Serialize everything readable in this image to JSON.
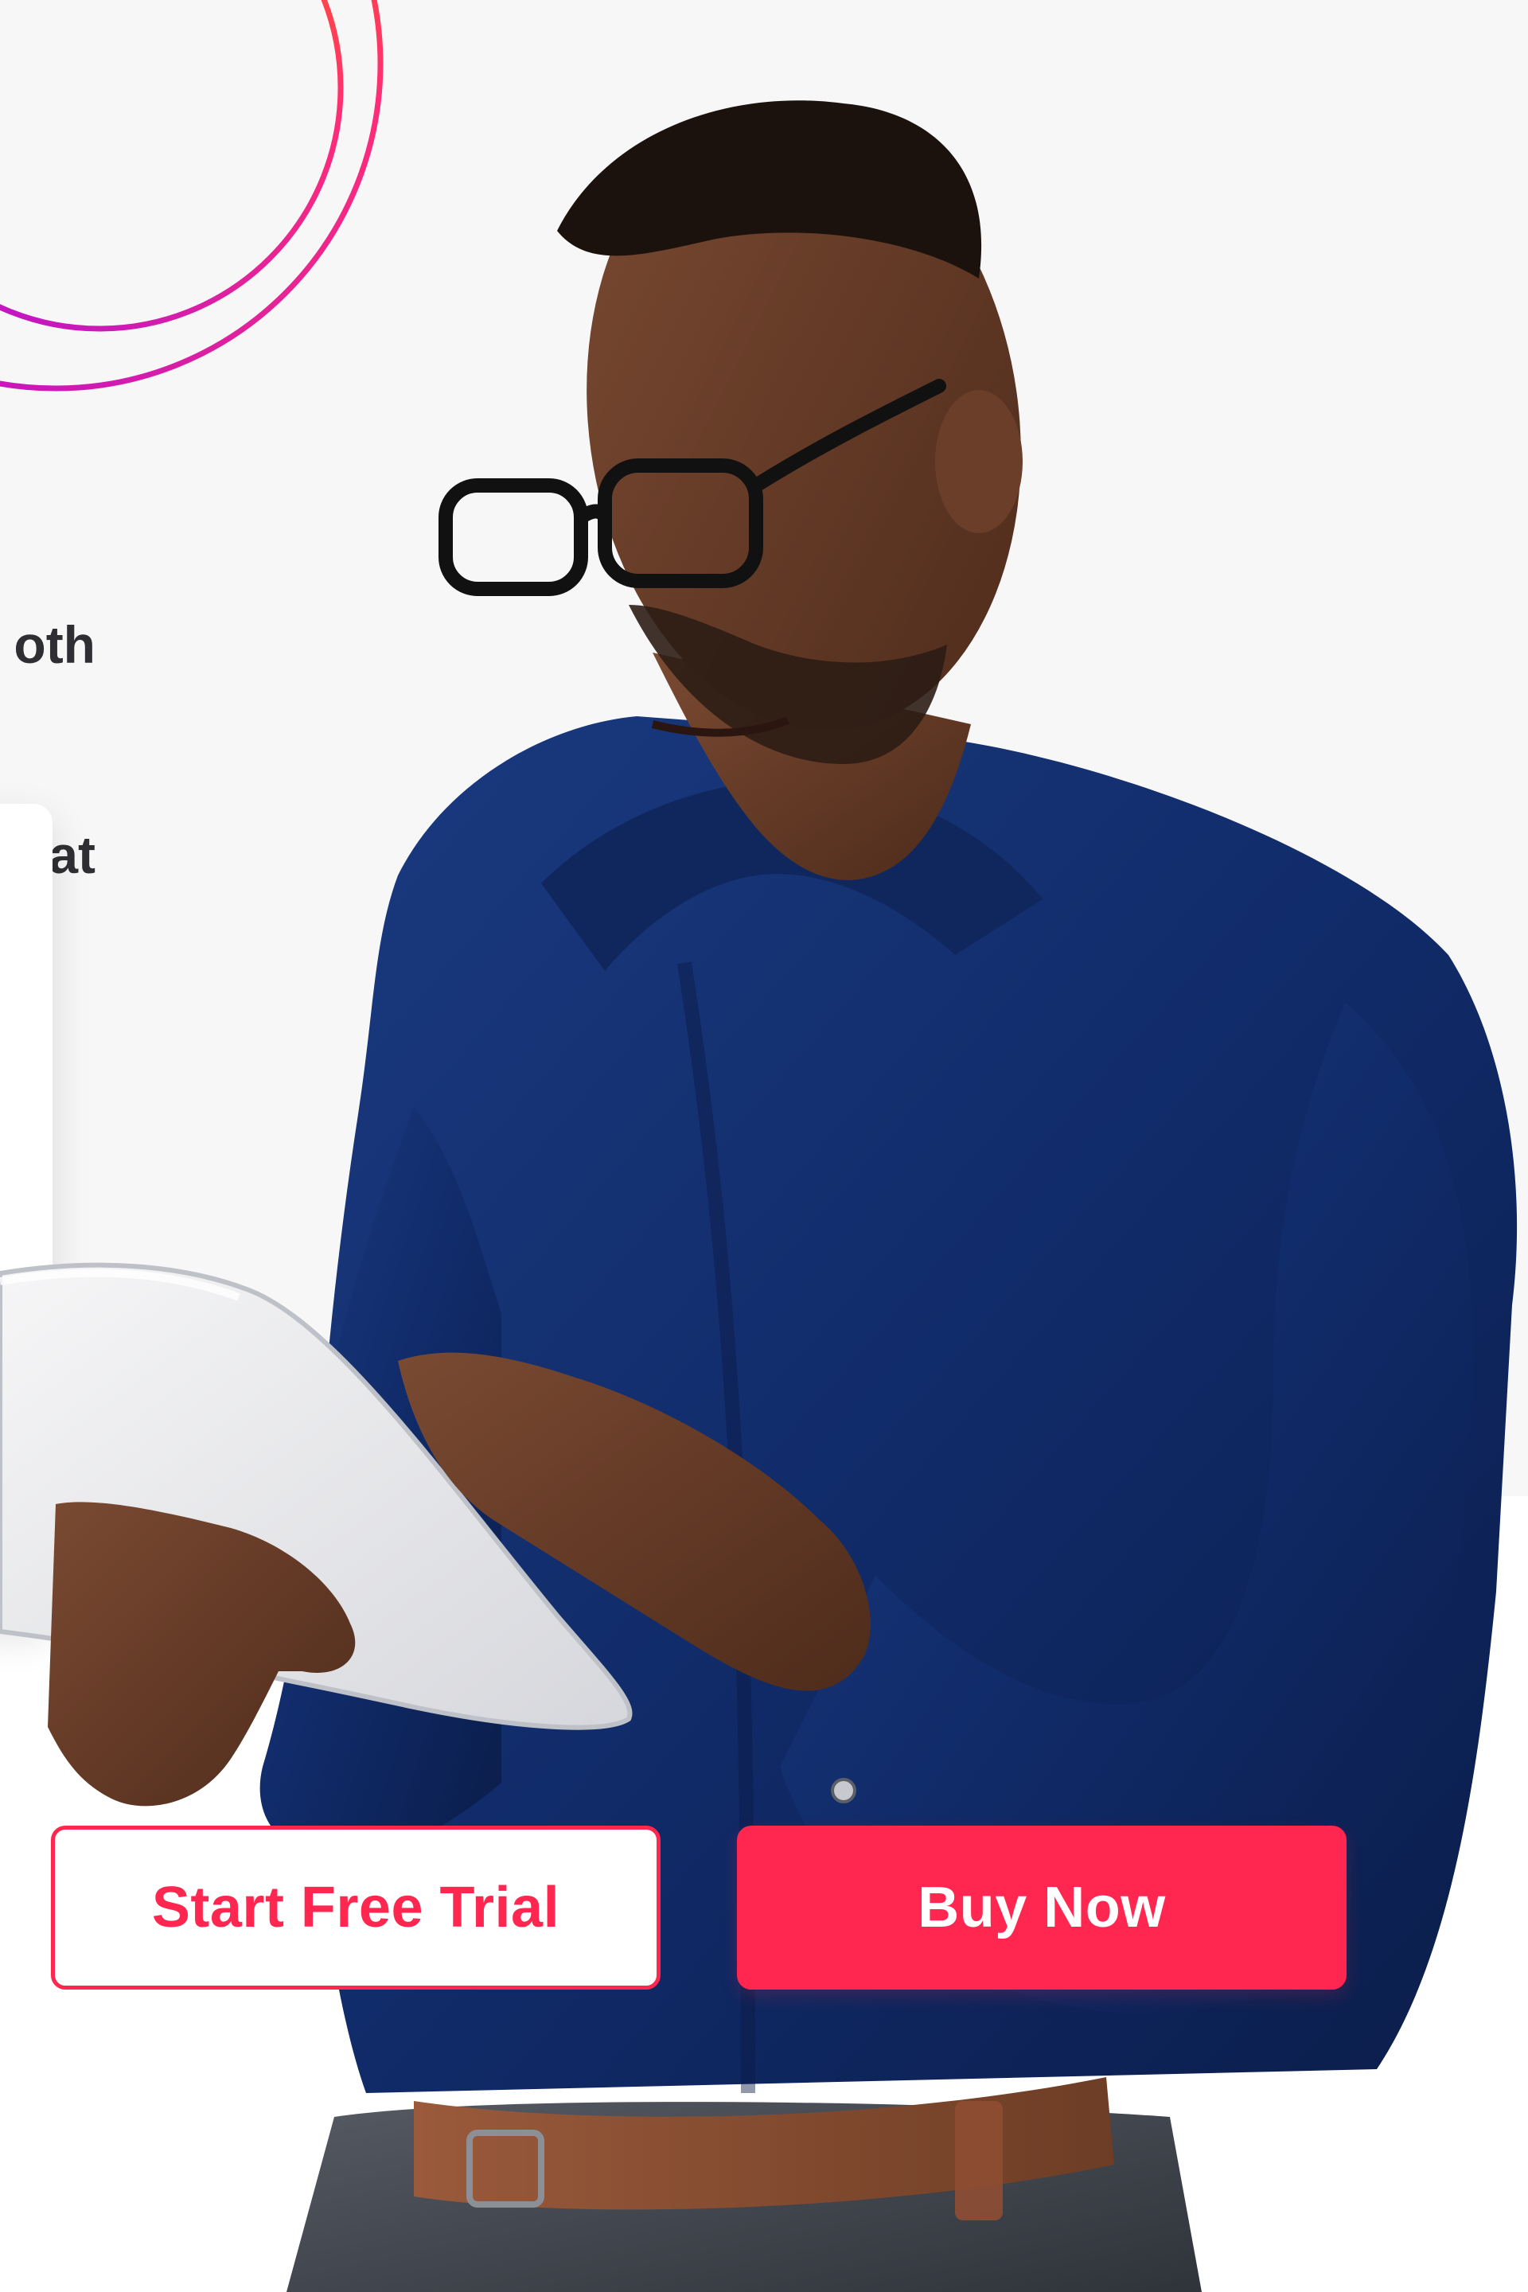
{
  "hero": {
    "headline_fragment": [
      "oth",
      "at"
    ],
    "image_subject": "man-with-tablet"
  },
  "cta": {
    "start_free_trial": "Start Free Trial",
    "buy_now": "Buy Now"
  },
  "colors": {
    "background": "#f7f7f8",
    "accent": "#ff264f",
    "ring_start": "#ff6a00",
    "ring_end": "#b10fd8",
    "text_dark": "#2f2f33",
    "shirt_navy": "#102a67"
  }
}
